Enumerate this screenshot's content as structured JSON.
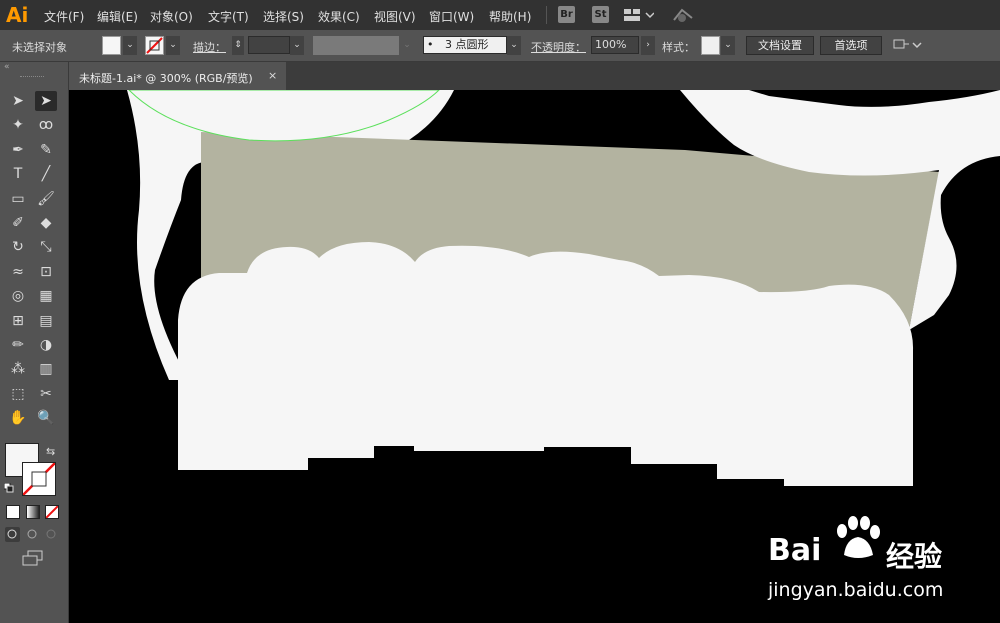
{
  "app": {
    "logo": "Ai"
  },
  "menu": [
    "文件(F)",
    "编辑(E)",
    "对象(O)",
    "文字(T)",
    "选择(S)",
    "效果(C)",
    "视图(V)",
    "窗口(W)",
    "帮助(H)"
  ],
  "menubar_badges": [
    "Br",
    "St"
  ],
  "control_bar": {
    "selection_status": "未选择对象",
    "stroke_label": "描边：",
    "brush_value": "3 点圆形",
    "brush_dot": "•",
    "opacity_label": "不透明度：",
    "opacity_value": "100%",
    "style_label": "样式：",
    "doc_settings_button": "文档设置",
    "preferences_button": "首选项"
  },
  "document_tab": {
    "title": "未标题-1.ai* @ 300% (RGB/预览)",
    "close": "×"
  },
  "toolbar_collapse": "«",
  "tools": [
    {
      "name": "selection-tool",
      "glyph": "➤"
    },
    {
      "name": "direct-selection-tool",
      "glyph": "➤"
    },
    {
      "name": "magic-wand-tool",
      "glyph": "✦"
    },
    {
      "name": "lasso-tool",
      "glyph": "ꝏ"
    },
    {
      "name": "pen-tool",
      "glyph": "✒"
    },
    {
      "name": "curvature-tool",
      "glyph": "✎"
    },
    {
      "name": "type-tool",
      "glyph": "T"
    },
    {
      "name": "line-segment-tool",
      "glyph": "╱"
    },
    {
      "name": "rectangle-tool",
      "glyph": "▭"
    },
    {
      "name": "paintbrush-tool",
      "glyph": "🖌"
    },
    {
      "name": "shaper-tool",
      "glyph": "✐"
    },
    {
      "name": "eraser-tool",
      "glyph": "◆"
    },
    {
      "name": "rotate-tool",
      "glyph": "↻"
    },
    {
      "name": "scale-tool",
      "glyph": "⤡"
    },
    {
      "name": "warp-tool",
      "glyph": "≈"
    },
    {
      "name": "free-transform-tool",
      "glyph": "⊡"
    },
    {
      "name": "shape-builder-tool",
      "glyph": "◎"
    },
    {
      "name": "perspective-grid-tool",
      "glyph": "▦"
    },
    {
      "name": "mesh-tool",
      "glyph": "⊞"
    },
    {
      "name": "gradient-tool",
      "glyph": "▤"
    },
    {
      "name": "eyedropper-tool",
      "glyph": "✏"
    },
    {
      "name": "blend-tool",
      "glyph": "◑"
    },
    {
      "name": "symbol-sprayer-tool",
      "glyph": "⁂"
    },
    {
      "name": "column-graph-tool",
      "glyph": "▥"
    },
    {
      "name": "artboard-tool",
      "glyph": "⬚"
    },
    {
      "name": "slice-tool",
      "glyph": "✂"
    },
    {
      "name": "hand-tool",
      "glyph": "✋"
    },
    {
      "name": "zoom-tool",
      "glyph": "🔍"
    }
  ],
  "colors": {
    "menubar": "#323232",
    "panel": "#535353",
    "canvas": "#000000",
    "gray_shape": "#b3b3a0",
    "white_shape": "#f6f6f6",
    "selection_outline": "#5ce05c",
    "accent_logo": "#ff9a00"
  },
  "watermark": {
    "brand_left": "Bai",
    "brand_right": "经验",
    "url": "jingyan.baidu.com"
  }
}
